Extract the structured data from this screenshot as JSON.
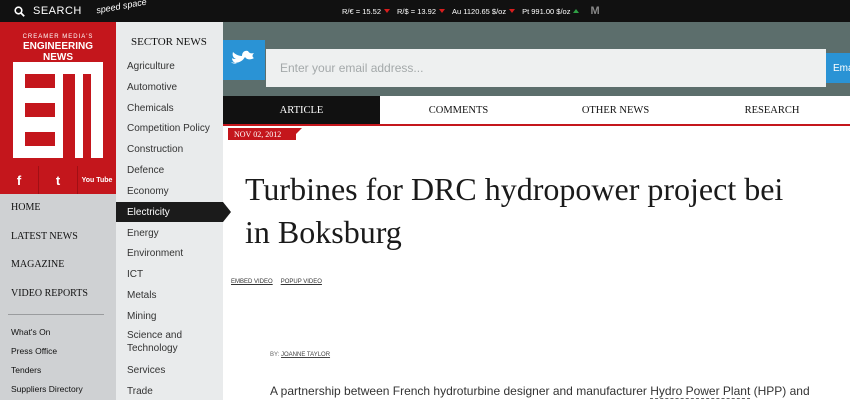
{
  "topbar": {
    "search_label": "SEARCH",
    "speed_brand": "speed space",
    "ticker": [
      {
        "text": "R/€ = 15.52",
        "trend": "down"
      },
      {
        "text": "R/$ = 13.92",
        "trend": "down"
      },
      {
        "text": "Au 1120.65 $/oz",
        "trend": "down"
      },
      {
        "text": "Pt 991.00 $/oz",
        "trend": "up"
      }
    ],
    "partner_logo": "M"
  },
  "logo": {
    "small_text": "CREAMER MEDIA'S",
    "big_text": "ENGINEERING NEWS"
  },
  "social": {
    "facebook": "f",
    "twitter": "t",
    "youtube": "You Tube"
  },
  "nav": {
    "main": [
      "HOME",
      "LATEST NEWS",
      "MAGAZINE",
      "VIDEO REPORTS"
    ],
    "sub": [
      "What's On",
      "Press Office",
      "Tenders",
      "Suppliers Directory"
    ]
  },
  "sector": {
    "title": "SECTOR NEWS",
    "items": [
      "Agriculture",
      "Automotive",
      "Chemicals",
      "Competition Policy",
      "Construction",
      "Defence",
      "Economy",
      "Electricity",
      "Energy",
      "Environment",
      "ICT",
      "Metals",
      "Mining",
      "Science and Technology",
      "Services",
      "Trade"
    ],
    "active": "Electricity"
  },
  "subscribe": {
    "placeholder": "Enter your email address...",
    "button": "Ema"
  },
  "tabs": [
    "ARTICLE",
    "COMMENTS",
    "OTHER NEWS",
    "RESEARCH"
  ],
  "article": {
    "date": "NOV 02, 2012",
    "headline_line1": "Turbines for DRC hydropower project bei",
    "headline_line2": "in Boksburg",
    "embed_video": "EMBED VIDEO",
    "popup_video": "POPUP VIDEO",
    "byline_prefix": "BY:",
    "author": "JOANNE TAYLOR",
    "lede_start": "A partnership between French hydroturbine designer and manufacturer ",
    "lede_link": "Hydro Power Plant",
    "lede_end": " (HPP) and"
  },
  "colors": {
    "brand_red": "#c4161c",
    "twitter_blue": "#2a93d5",
    "dark": "#111111"
  }
}
